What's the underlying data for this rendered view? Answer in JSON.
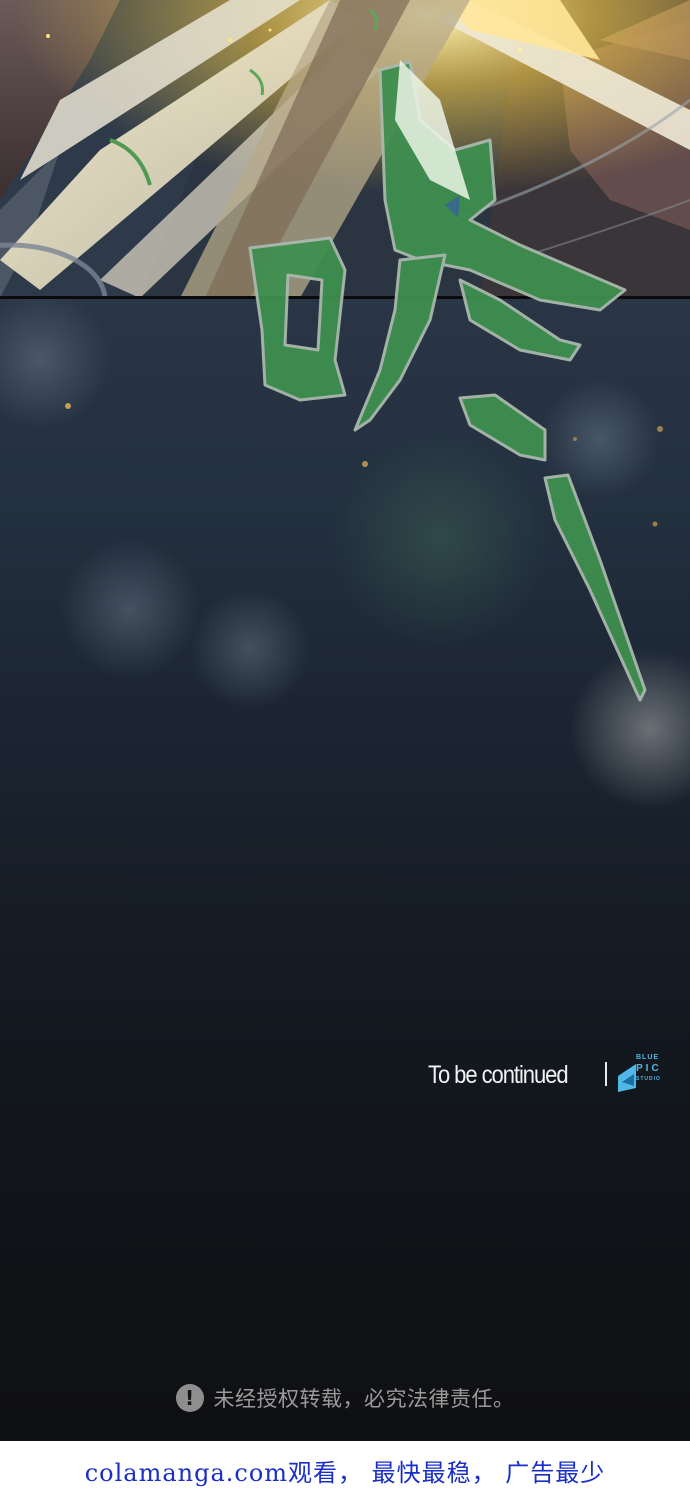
{
  "panels": {
    "top_action_scene": "sword-impact-panel",
    "lower_scene": "dark-bokeh-panel"
  },
  "sfx": {
    "text": "咚",
    "color": "#3f8f4f"
  },
  "ending": {
    "text": "To be continued",
    "studio_logo_lines": [
      "BLUE",
      "PIC",
      "STUDIO"
    ],
    "logo_color": "#4fb8e8"
  },
  "notice": {
    "icon": "exclamation-icon",
    "text": "未经授权转载，必究法律责任。"
  },
  "footer": {
    "text": "colamanga.com观看， 最快最稳， 广告最少",
    "color": "#1a2ec8"
  }
}
